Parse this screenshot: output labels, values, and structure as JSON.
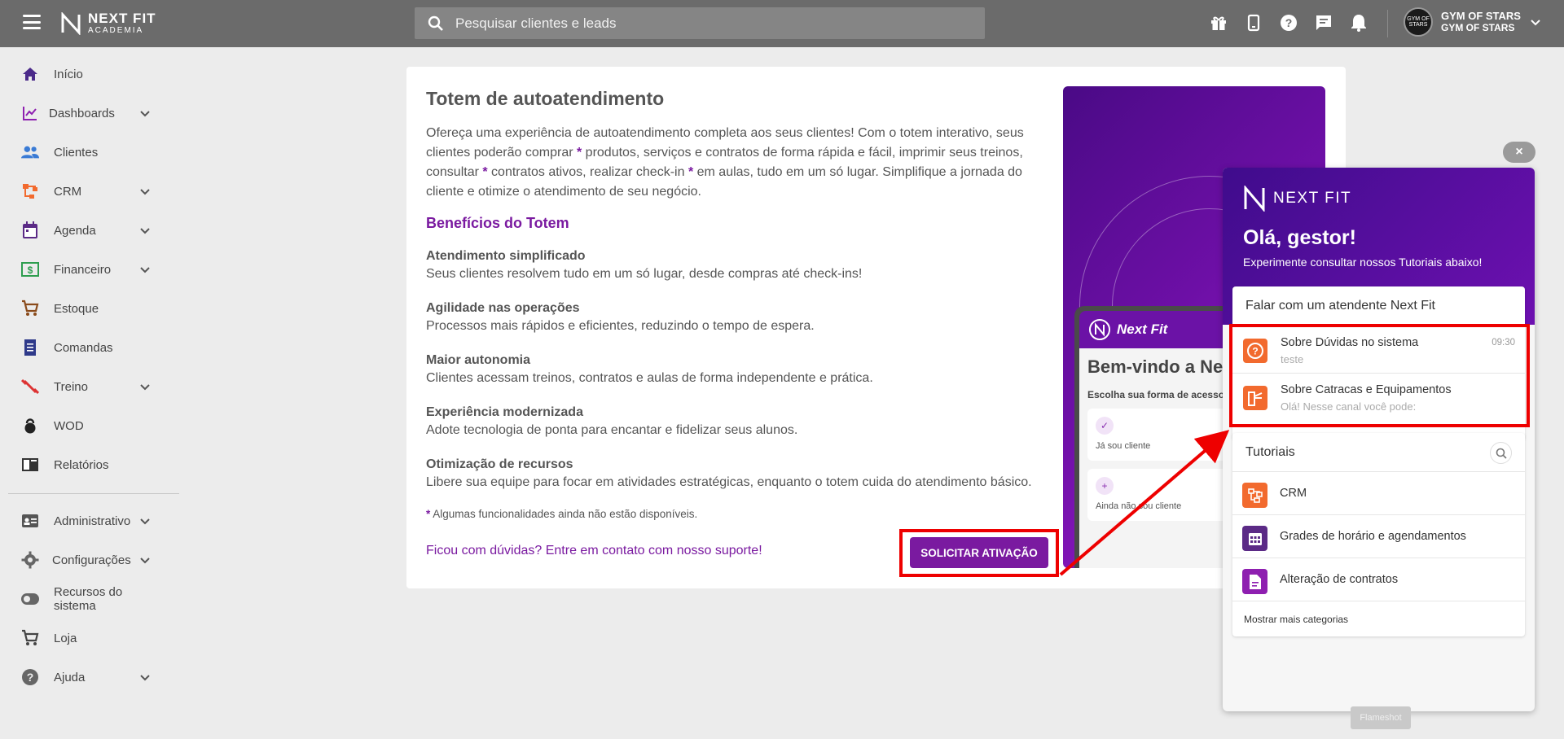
{
  "brand": {
    "line1": "NEXT FIT",
    "line2": "ACADEMIA"
  },
  "search": {
    "placeholder": "Pesquisar clientes e leads"
  },
  "topbar_icons": [
    "gift-icon",
    "phone-icon",
    "help-icon",
    "chat-icon",
    "bell-icon"
  ],
  "account": {
    "name": "GYM OF STARS",
    "sub": "GYM OF STARS",
    "avatar_text": "GYM OF STARS"
  },
  "sidebar": {
    "items": [
      {
        "label": "Início",
        "icon": "home-icon",
        "chevron": false
      },
      {
        "label": "Dashboards",
        "icon": "chart-icon",
        "chevron": true
      },
      {
        "label": "Clientes",
        "icon": "people-icon",
        "chevron": false
      },
      {
        "label": "CRM",
        "icon": "crm-icon",
        "chevron": true
      },
      {
        "label": "Agenda",
        "icon": "calendar-icon",
        "chevron": true
      },
      {
        "label": "Financeiro",
        "icon": "money-icon",
        "chevron": true
      },
      {
        "label": "Estoque",
        "icon": "cart-icon",
        "chevron": false
      },
      {
        "label": "Comandas",
        "icon": "receipt-icon",
        "chevron": false
      },
      {
        "label": "Treino",
        "icon": "dumbbell-icon",
        "chevron": true
      },
      {
        "label": "WOD",
        "icon": "kettlebell-icon",
        "chevron": false
      },
      {
        "label": "Relatórios",
        "icon": "report-icon",
        "chevron": false
      },
      {
        "label": "Administrativo",
        "icon": "id-card-icon",
        "chevron": true
      },
      {
        "label": "Configurações",
        "icon": "gear-icon",
        "chevron": true
      },
      {
        "label": "Recursos do sistema",
        "icon": "toggle-icon",
        "chevron": false
      },
      {
        "label": "Loja",
        "icon": "cart-icon",
        "chevron": false
      },
      {
        "label": "Ajuda",
        "icon": "help-circle-icon",
        "chevron": true
      }
    ]
  },
  "main": {
    "title": "Totem de autoatendimento",
    "desc_parts": [
      "Ofereça uma experiência de autoatendimento completa aos seus clientes! Com o totem interativo, seus clientes poderão comprar ",
      "*",
      " produtos, serviços e contratos de forma rápida e fácil, imprimir seus treinos, consultar ",
      "*",
      " contratos ativos, realizar check-in ",
      "*",
      " em aulas, tudo em um só lugar. Simplifique a jornada do cliente e otimize o atendimento de seu negócio."
    ],
    "benefits_title": "Benefícios do Totem",
    "benefits": [
      {
        "title": "Atendimento simplificado",
        "desc": "Seus clientes resolvem tudo em um só lugar, desde compras até check-ins!"
      },
      {
        "title": "Agilidade nas operações",
        "desc": "Processos mais rápidos e eficientes, reduzindo o tempo de espera."
      },
      {
        "title": "Maior autonomia",
        "desc": "Clientes acessam treinos, contratos e aulas de forma independente e prática."
      },
      {
        "title": "Experiência modernizada",
        "desc": "Adote tecnologia de ponta para encantar e fidelizar seus alunos."
      },
      {
        "title": "Otimização de recursos",
        "desc": "Libere sua equipe para focar em atividades estratégicas, enquanto o totem cuida do atendimento básico."
      }
    ],
    "footnote_star": "*",
    "footnote": " Algumas funcionalidades ainda não estão disponíveis.",
    "support_link": "Ficou com dúvidas? Entre em contato com nosso suporte!",
    "activate_button": "SOLICITAR ATIVAÇÃO"
  },
  "promo": {
    "brand": "Next Fit",
    "welcome": "Bem-vindo a Next Fit",
    "choose": "Escolha sua forma de acesso",
    "options": [
      "Já sou cliente",
      "Ainda não sou cliente"
    ]
  },
  "help_panel": {
    "close": "×",
    "logo": "NEXT FIT",
    "greeting": "Olá, gestor!",
    "subtitle": "Experimente consultar nossos Tutoriais abaixo!",
    "attend_title": "Falar com um atendente Next Fit",
    "conversations": [
      {
        "title": "Sobre Dúvidas no sistema",
        "message": "teste",
        "time": "09:30",
        "icon": "question-icon"
      },
      {
        "title": "Sobre Catracas e Equipamentos",
        "message": "Olá! Nesse canal você pode:",
        "time": "",
        "icon": "turnstile-icon"
      }
    ],
    "tutorials_title": "Tutoriais",
    "tutorials": [
      {
        "label": "CRM",
        "icon": "crm-icon",
        "color": "#f26a2e"
      },
      {
        "label": "Grades de horário e agendamentos",
        "icon": "calendar-grid-icon",
        "color": "#5b2a86"
      },
      {
        "label": "Alteração de contratos",
        "icon": "document-icon",
        "color": "#8e1fb0"
      }
    ],
    "more": "Mostrar mais categorias"
  },
  "overlay_label": "Flameshot",
  "colors": {
    "topbar": "#6b6b6b",
    "accent": "#7a1aa0",
    "annotation": "#ee0000"
  }
}
